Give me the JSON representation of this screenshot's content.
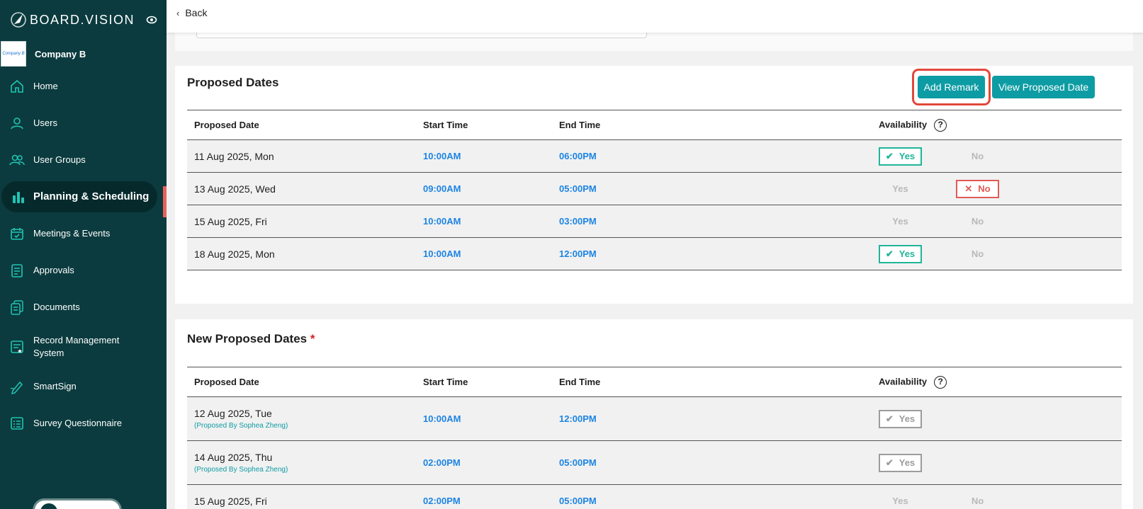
{
  "brand": {
    "name": "BOARD.VISION"
  },
  "company": {
    "logo_text": "Company B",
    "name": "Company B"
  },
  "sidebar": {
    "items": [
      {
        "label": "Home",
        "icon": "home-icon"
      },
      {
        "label": "Users",
        "icon": "user-icon"
      },
      {
        "label": "User Groups",
        "icon": "user-group-icon"
      },
      {
        "label": "Planning & Scheduling",
        "icon": "bar-chart-icon",
        "active": true
      },
      {
        "label": "Meetings & Events",
        "icon": "calendar-check-icon"
      },
      {
        "label": "Approvals",
        "icon": "document-list-icon"
      },
      {
        "label": "Documents",
        "icon": "documents-icon"
      },
      {
        "label": "Record Management System",
        "icon": "record-icon"
      },
      {
        "label": "SmartSign",
        "icon": "pen-icon"
      },
      {
        "label": "Survey Questionnaire",
        "icon": "checklist-icon"
      }
    ]
  },
  "header": {
    "back_label": "Back"
  },
  "proposed_dates": {
    "title": "Proposed Dates",
    "buttons": {
      "add_remark": "Add Remark",
      "view_proposed": "View Proposed Date"
    },
    "columns": [
      "Proposed Date",
      "Start Time",
      "End Time",
      "Availability"
    ],
    "rows": [
      {
        "date": "11 Aug 2025, Mon",
        "start": "10:00AM",
        "end": "06:00PM",
        "selected": "yes"
      },
      {
        "date": "13 Aug 2025, Wed",
        "start": "09:00AM",
        "end": "05:00PM",
        "selected": "no"
      },
      {
        "date": "15 Aug 2025, Fri",
        "start": "10:00AM",
        "end": "03:00PM",
        "selected": "none"
      },
      {
        "date": "18 Aug 2025, Mon",
        "start": "10:00AM",
        "end": "12:00PM",
        "selected": "yes"
      }
    ]
  },
  "new_proposed_dates": {
    "title": "New Proposed Dates",
    "required_mark": "*",
    "columns": [
      "Proposed Date",
      "Start Time",
      "End Time",
      "Availability"
    ],
    "rows": [
      {
        "date": "12 Aug 2025, Tue",
        "proposer": "(Proposed By Sophea Zheng)",
        "start": "10:00AM",
        "end": "12:00PM",
        "selected": "yes-dim"
      },
      {
        "date": "14 Aug 2025, Thu",
        "proposer": "(Proposed By Sophea Zheng)",
        "start": "02:00PM",
        "end": "05:00PM",
        "selected": "yes-dim"
      },
      {
        "date": "15 Aug 2025, Fri",
        "proposer": "",
        "start": "02:00PM",
        "end": "05:00PM",
        "selected": "none"
      }
    ]
  },
  "availability_options": {
    "yes": "Yes",
    "no": "No"
  },
  "colors": {
    "sidebar": "#0b3b3e",
    "accent": "#0e9ca4",
    "time": "#1c84e3",
    "yes": "#1fb59a",
    "no": "#e25a56",
    "highlight": "#e2483b"
  }
}
